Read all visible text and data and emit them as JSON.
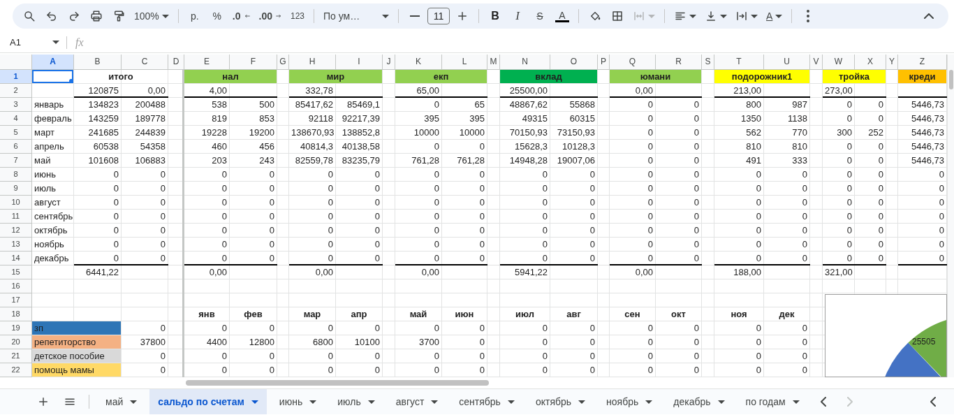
{
  "toolbar": {
    "zoom": "100%",
    "currency": "р.",
    "percent": "%",
    "decrease_decimals": ".0",
    "increase_decimals": ".00",
    "number_format": "123",
    "font": "По ум…",
    "font_size": "11",
    "bold": "B",
    "italic": "I",
    "strikethrough": "S",
    "text_color": "A",
    "rotation": "A",
    "merge": {
      "disabled": true
    }
  },
  "formula_bar": {
    "name_box": "A1",
    "fx": "fx"
  },
  "columns": [
    {
      "letter": "A",
      "selected": true
    },
    {
      "letter": "B",
      "selected": false
    },
    {
      "letter": "C",
      "selected": false
    },
    {
      "letter": "D",
      "selected": false
    },
    {
      "letter": "E",
      "selected": false
    },
    {
      "letter": "F",
      "selected": false
    },
    {
      "letter": "G",
      "selected": false
    },
    {
      "letter": "H",
      "selected": false
    },
    {
      "letter": "I",
      "selected": false
    },
    {
      "letter": "J",
      "selected": false
    },
    {
      "letter": "K",
      "selected": false
    },
    {
      "letter": "L",
      "selected": false
    },
    {
      "letter": "M",
      "selected": false
    },
    {
      "letter": "N",
      "selected": false
    },
    {
      "letter": "O",
      "selected": false
    },
    {
      "letter": "P",
      "selected": false
    },
    {
      "letter": "Q",
      "selected": false
    },
    {
      "letter": "R",
      "selected": false
    },
    {
      "letter": "S",
      "selected": false
    },
    {
      "letter": "T",
      "selected": false
    },
    {
      "letter": "U",
      "selected": false
    },
    {
      "letter": "V",
      "selected": false
    },
    {
      "letter": "W",
      "selected": false
    },
    {
      "letter": "X",
      "selected": false
    },
    {
      "letter": "Y",
      "selected": false
    },
    {
      "letter": "Z",
      "selected": false
    }
  ],
  "rows": [
    {
      "number": "1",
      "selected": true
    },
    {
      "number": "2",
      "selected": false
    },
    {
      "number": "3",
      "selected": false
    },
    {
      "number": "4",
      "selected": false
    },
    {
      "number": "5",
      "selected": false
    },
    {
      "number": "6",
      "selected": false
    },
    {
      "number": "7",
      "selected": false
    },
    {
      "number": "8",
      "selected": false
    },
    {
      "number": "9",
      "selected": false
    },
    {
      "number": "10",
      "selected": false
    },
    {
      "number": "11",
      "selected": false
    },
    {
      "number": "12",
      "selected": false
    },
    {
      "number": "13",
      "selected": false
    },
    {
      "number": "14",
      "selected": false
    },
    {
      "number": "15",
      "selected": false
    },
    {
      "number": "16",
      "selected": false
    },
    {
      "number": "17",
      "selected": false
    },
    {
      "number": "18",
      "selected": false
    },
    {
      "number": "19",
      "selected": false
    },
    {
      "number": "20",
      "selected": false
    },
    {
      "number": "21",
      "selected": false
    },
    {
      "number": "22",
      "selected": false
    }
  ],
  "months": [
    "январь",
    "февраль",
    "март",
    "апрель",
    "май",
    "июнь",
    "июль",
    "август",
    "сентябрь",
    "октябрь",
    "ноябрь",
    "декабрь"
  ],
  "blocks": [
    {
      "title": "итого",
      "opening": [
        "120875",
        "0,00"
      ],
      "months": [
        [
          "134823",
          "200488"
        ],
        [
          "143259",
          "189778"
        ],
        [
          "241685",
          "244839"
        ],
        [
          "60538",
          "54358"
        ],
        [
          "101608",
          "106883"
        ],
        [
          "0",
          "0"
        ],
        [
          "0",
          "0"
        ],
        [
          "0",
          "0"
        ],
        [
          "0",
          "0"
        ],
        [
          "0",
          "0"
        ],
        [
          "0",
          "0"
        ],
        [
          "0",
          "0"
        ]
      ],
      "closing": [
        "6441,22"
      ]
    },
    {
      "title": "нал",
      "color": "#92d050",
      "opening": [
        "4,00"
      ],
      "months": [
        [
          "538",
          "500"
        ],
        [
          "819",
          "853"
        ],
        [
          "19228",
          "19200"
        ],
        [
          "460",
          "456"
        ],
        [
          "203",
          "243"
        ],
        [
          "0",
          "0"
        ],
        [
          "0",
          "0"
        ],
        [
          "0",
          "0"
        ],
        [
          "0",
          "0"
        ],
        [
          "0",
          "0"
        ],
        [
          "0",
          "0"
        ],
        [
          "0",
          "0"
        ]
      ],
      "closing": [
        "0,00"
      ]
    },
    {
      "title": "мир",
      "color": "#92d050",
      "opening": [
        "332,78"
      ],
      "months": [
        [
          "85417,62",
          "85469,1"
        ],
        [
          "92118",
          "92217,39"
        ],
        [
          "138670,93",
          "138852,8"
        ],
        [
          "40814,3",
          "40138,58"
        ],
        [
          "82559,78",
          "83235,79"
        ],
        [
          "0",
          "0"
        ],
        [
          "0",
          "0"
        ],
        [
          "0",
          "0"
        ],
        [
          "0",
          "0"
        ],
        [
          "0",
          "0"
        ],
        [
          "0",
          "0"
        ],
        [
          "0",
          "0"
        ]
      ],
      "closing": [
        "0,00"
      ]
    },
    {
      "title": "екп",
      "color": "#92d050",
      "opening": [
        "65,00"
      ],
      "months": [
        [
          "0",
          "65"
        ],
        [
          "395",
          "395"
        ],
        [
          "10000",
          "10000"
        ],
        [
          "0",
          "0"
        ],
        [
          "761,28",
          "761,28"
        ],
        [
          "0",
          "0"
        ],
        [
          "0",
          "0"
        ],
        [
          "0",
          "0"
        ],
        [
          "0",
          "0"
        ],
        [
          "0",
          "0"
        ],
        [
          "0",
          "0"
        ],
        [
          "0",
          "0"
        ]
      ],
      "closing": [
        "0,00"
      ]
    },
    {
      "title": "вклад",
      "color": "#00b050",
      "opening": [
        "25500,00"
      ],
      "months": [
        [
          "48867,62",
          "55868"
        ],
        [
          "49315",
          "60315"
        ],
        [
          "70150,93",
          "73150,93"
        ],
        [
          "15628,3",
          "10128,3"
        ],
        [
          "14948,28",
          "19007,06"
        ],
        [
          "0",
          "0"
        ],
        [
          "0",
          "0"
        ],
        [
          "0",
          "0"
        ],
        [
          "0",
          "0"
        ],
        [
          "0",
          "0"
        ],
        [
          "0",
          "0"
        ],
        [
          "0",
          "0"
        ]
      ],
      "closing": [
        "5941,22"
      ]
    },
    {
      "title": "юмани",
      "color": "#92d050",
      "opening": [
        "0,00"
      ],
      "months": [
        [
          "0",
          "0"
        ],
        [
          "0",
          "0"
        ],
        [
          "0",
          "0"
        ],
        [
          "0",
          "0"
        ],
        [
          "0",
          "0"
        ],
        [
          "0",
          "0"
        ],
        [
          "0",
          "0"
        ],
        [
          "0",
          "0"
        ],
        [
          "0",
          "0"
        ],
        [
          "0",
          "0"
        ],
        [
          "0",
          "0"
        ],
        [
          "0",
          "0"
        ]
      ],
      "closing": [
        "0,00"
      ]
    },
    {
      "title": "подорожник1",
      "color": "#ffff00",
      "opening": [
        "213,00"
      ],
      "months": [
        [
          "800",
          "987"
        ],
        [
          "1350",
          "1138"
        ],
        [
          "562",
          "770"
        ],
        [
          "810",
          "810"
        ],
        [
          "491",
          "333"
        ],
        [
          "0",
          "0"
        ],
        [
          "0",
          "0"
        ],
        [
          "0",
          "0"
        ],
        [
          "0",
          "0"
        ],
        [
          "0",
          "0"
        ],
        [
          "0",
          "0"
        ],
        [
          "0",
          "0"
        ]
      ],
      "closing": [
        "188,00"
      ]
    },
    {
      "title": "тройка",
      "color": "#ffff00",
      "opening": [
        "273,00"
      ],
      "months": [
        [
          "0",
          "0"
        ],
        [
          "0",
          "0"
        ],
        [
          "300",
          "252"
        ],
        [
          "0",
          "0"
        ],
        [
          "0",
          "0"
        ],
        [
          "0",
          "0"
        ],
        [
          "0",
          "0"
        ],
        [
          "0",
          "0"
        ],
        [
          "0",
          "0"
        ],
        [
          "0",
          "0"
        ],
        [
          "0",
          "0"
        ],
        [
          "0",
          "0"
        ]
      ],
      "closing": [
        "321,00"
      ]
    },
    {
      "title": "креди",
      "color": "#ffc000",
      "months": [
        [
          "5446,73"
        ],
        [
          "5446,73"
        ],
        [
          "5446,73"
        ],
        [
          "5446,73"
        ],
        [
          "5446,73"
        ],
        [
          "0"
        ],
        [
          "0"
        ],
        [
          "0"
        ],
        [
          "0"
        ],
        [
          "0"
        ],
        [
          "0"
        ],
        [
          "0"
        ]
      ]
    }
  ],
  "month_headers": [
    "янв",
    "фев",
    "мар",
    "апр",
    "май",
    "июн",
    "июл",
    "авг",
    "сен",
    "окт",
    "ноя",
    "дек"
  ],
  "income": [
    {
      "label": "зп",
      "color": "#2e75b6",
      "total": "0",
      "values": [
        "0",
        "0",
        "0",
        "0",
        "0",
        "0",
        "0",
        "0",
        "0",
        "0",
        "0",
        "0"
      ]
    },
    {
      "label": "репетиторство",
      "color": "#f4b183",
      "total": "37800",
      "values": [
        "4400",
        "12800",
        "6800",
        "10100",
        "3700",
        "0",
        "0",
        "0",
        "0",
        "0",
        "0",
        "0"
      ]
    },
    {
      "label": "детское пособие",
      "color": "#d9d9d9",
      "total": "0",
      "values": [
        "0",
        "0",
        "0",
        "0",
        "0",
        "0",
        "0",
        "0",
        "0",
        "0",
        "0",
        "0"
      ]
    },
    {
      "label": "помощь мамы",
      "color": "#ffd966",
      "total": "0",
      "values": [
        "0",
        "0",
        "0",
        "0",
        "0",
        "0",
        "0",
        "0",
        "0",
        "0",
        "0",
        "0"
      ]
    }
  ],
  "chart": {
    "label": "25505"
  },
  "sheet_tabs": [
    {
      "label": "май",
      "selected": false
    },
    {
      "label": "сальдо по счетам",
      "selected": true
    },
    {
      "label": "июнь",
      "selected": false
    },
    {
      "label": "июль",
      "selected": false
    },
    {
      "label": "август",
      "selected": false
    },
    {
      "label": "сентябрь",
      "selected": false
    },
    {
      "label": "октябрь",
      "selected": false
    },
    {
      "label": "ноябрь",
      "selected": false
    },
    {
      "label": "декабрь",
      "selected": false
    },
    {
      "label": "по годам",
      "selected": false
    }
  ]
}
